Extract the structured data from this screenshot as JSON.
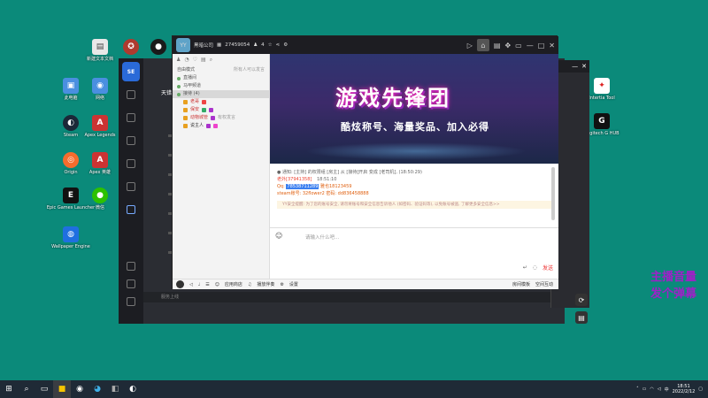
{
  "desktop": {
    "icons": [
      {
        "name": "new-text-document",
        "label": "新建文本文档",
        "color": "#e8e8e8",
        "glyph": "▤"
      },
      {
        "name": "recycle-bin",
        "label": "此电脑",
        "color": "#4a8fe0",
        "glyph": "▣"
      },
      {
        "name": "network",
        "label": "网络",
        "color": "#4a8fe0",
        "glyph": "◉"
      },
      {
        "name": "steam",
        "label": "Steam",
        "color": "#1b2838",
        "glyph": "◐"
      },
      {
        "name": "apex-legends-1",
        "label": "Apex Legends",
        "color": "#c33",
        "glyph": "A"
      },
      {
        "name": "origin",
        "label": "Origin",
        "color": "#f56c2d",
        "glyph": "◎"
      },
      {
        "name": "apex-legends-2",
        "label": "Apex 英雄",
        "color": "#c33",
        "glyph": "A"
      },
      {
        "name": "epic-games",
        "label": "Epic Games Launcher",
        "color": "#111",
        "glyph": "E"
      },
      {
        "name": "wechat",
        "label": "微信",
        "color": "#2dc100",
        "glyph": "●"
      },
      {
        "name": "wallpaper-engine",
        "label": "Wallpaper Engine",
        "color": "#1f6fe0",
        "glyph": "◍"
      },
      {
        "name": "right-app-1",
        "label": "Intertia Tool",
        "color": "#d22",
        "glyph": "✦"
      },
      {
        "name": "right-app-2",
        "label": "Logitech G HUB",
        "color": "#111",
        "glyph": "G"
      }
    ]
  },
  "launcher": {
    "logo_text": "SE",
    "tab_label": "天错",
    "bottom_text": "服务上线"
  },
  "main_window": {
    "titlebar": {
      "channel_name": "黑暗公司",
      "channel_id": "27459054",
      "online_count": "4",
      "avatar_text": "YY"
    },
    "left_pane": {
      "mode_label": "自由模式",
      "sub_label": "所有人可以发言",
      "rows": [
        {
          "label": "直播间",
          "selected": false
        },
        {
          "label": "马甲频道",
          "selected": false
        },
        {
          "label": "接待 (4)",
          "selected": true
        },
        {
          "label": "老哥",
          "selected": false
        },
        {
          "label": "保安",
          "selected": false
        },
        {
          "label": "动物城管",
          "selected": false
        },
        {
          "label": "说主人",
          "selected": false
        }
      ],
      "row_note": "有权发言"
    },
    "banner": {
      "title": "游戏先锋团",
      "subtitle": "酷炫称号、海量奖品、加入必得"
    },
    "chat": {
      "system_line": "● 通知: [主持] 的权限组 [房主] 从 [接待]开启 变成 [老司机], (18:50:29)",
      "msg_user": "老外[37941358]",
      "msg_time": "18:51:10",
      "line_qq_label": "Qq:",
      "line_qq_highlight": "78538711289",
      "line_qq_rest": "雅也18123459",
      "line_steam": "steam账号: 32flower2 密码: dd836458888",
      "notice": "YY安全提醒: 为了您的账号安全, 请勿将账号和安全信息告诉他人 (如密码、验证码等), 以免账号被盗, 了解更多安全信息>>"
    },
    "input": {
      "placeholder": "请输入什么吧..."
    },
    "send_bar": {
      "send_label": "发送"
    },
    "bottom_bar": {
      "items": [
        "应用商店",
        "播放伴奏",
        "设置"
      ],
      "right_items": [
        "房间模板",
        "空间互动"
      ]
    }
  },
  "overlay_text": {
    "line1": "主播音量",
    "line2": "发个弹幕"
  },
  "taskbar": {
    "time": "18:51",
    "date": "2022/2/12",
    "tray_label": "中"
  }
}
